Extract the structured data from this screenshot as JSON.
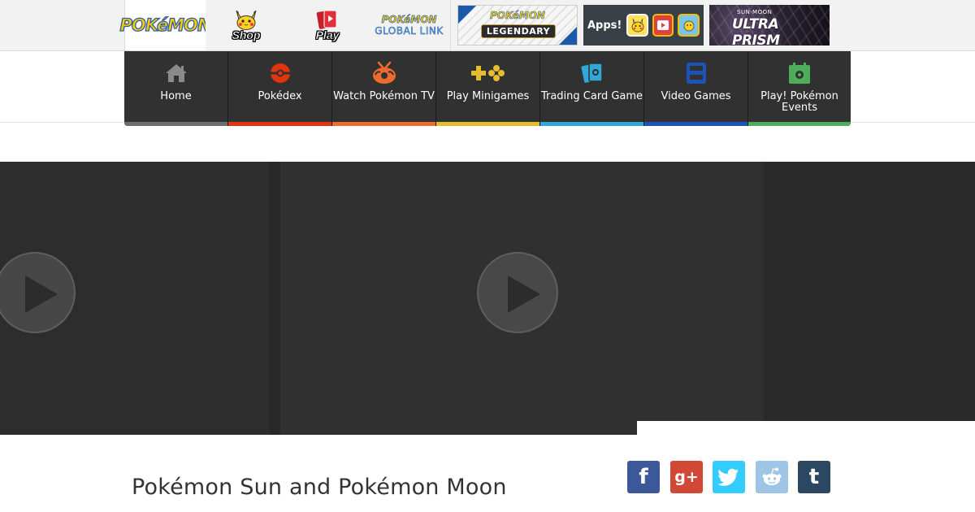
{
  "brand_tabs": [
    {
      "name": "pokemon-home",
      "logo_text": "POKéMON"
    },
    {
      "name": "shop",
      "label": "Shop"
    },
    {
      "name": "play",
      "label": "Play"
    },
    {
      "name": "global-link",
      "logo_top": "POKéMON",
      "logo_bottom": "GLOBAL LINK"
    }
  ],
  "promos": {
    "legendary": {
      "logo": "POKéMON",
      "banner": "LEGENDARY"
    },
    "apps": {
      "label": "Apps!"
    },
    "ultra": {
      "small": "SUN·MOON",
      "title": "ULTRA PRISM"
    }
  },
  "nav": {
    "items": [
      {
        "label": "Home",
        "icon": "home-icon",
        "color": "#6d6d6d"
      },
      {
        "label": "Pokédex",
        "icon": "pokeball-icon",
        "color": "#e3350d"
      },
      {
        "label": "Watch Pokémon TV",
        "icon": "tv-icon",
        "color": "#ee6b2f"
      },
      {
        "label": "Play Minigames",
        "icon": "gamepad-icon",
        "color": "#e6bc2f"
      },
      {
        "label": "Trading Card Game",
        "icon": "cards-icon",
        "color": "#30a7d7"
      },
      {
        "label": "Video Games",
        "icon": "ds-console-icon",
        "color": "#1b53ba"
      },
      {
        "label": "Play! Pokémon Events",
        "icon": "calendar-icon",
        "color": "#4dad5b"
      }
    ]
  },
  "page": {
    "title": "Pokémon Sun and Pokémon Moon"
  },
  "share": {
    "facebook": "f",
    "google_plus": "g+",
    "tumblr": "t"
  },
  "colors": {
    "nav_bg": "#313131",
    "video_bg": "#2e2e2e",
    "title_text": "#333333"
  }
}
